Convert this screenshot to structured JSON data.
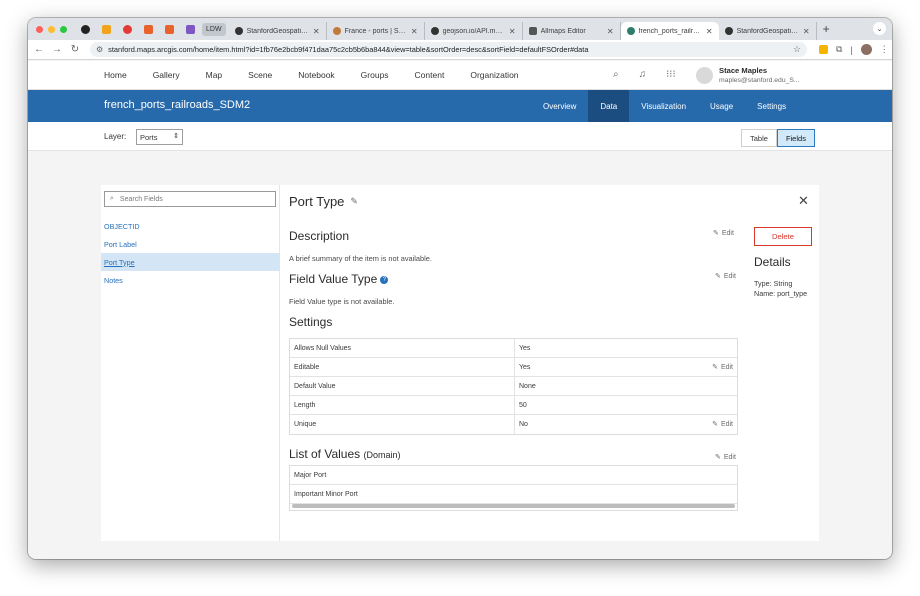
{
  "browser": {
    "pinned_tab_icons": [
      "github-icon",
      "chart-icon",
      "youtube-icon",
      "arcgis-icon",
      "wrench-icon",
      "vscode-icon"
    ],
    "ldw_label": "LDW",
    "tabs": [
      {
        "title": "StanfordGeospatialCe",
        "icon": "github-icon",
        "color": "#333333"
      },
      {
        "title": "France - ports | Stanfo",
        "icon": "globe-icon",
        "color": "#c07a3a"
      },
      {
        "title": "geojson.io/API.md at",
        "icon": "github-icon",
        "color": "#333333"
      },
      {
        "title": "Allmaps Editor",
        "icon": "map-icon",
        "color": "#555555"
      },
      {
        "title": "french_ports_railroad",
        "icon": "arcgis-icon",
        "color": "#2e7d6b",
        "active": true
      },
      {
        "title": "StanfordGeospatialCe",
        "icon": "github-icon",
        "color": "#333333"
      }
    ],
    "url": "stanford.maps.arcgis.com/home/item.html?id=1fb76e2bcb9f471daa75c2cb5b6ba844&view=table&sortOrder=desc&sortField=defaultFSOrder#data"
  },
  "topnav": {
    "links": [
      "Home",
      "Gallery",
      "Map",
      "Scene",
      "Notebook",
      "Groups",
      "Content",
      "Organization"
    ],
    "user_name": "Stace Maples",
    "user_email": "maples@stanford.edu_S..."
  },
  "item": {
    "title": "french_ports_railroads_SDM2",
    "tabs": [
      "Overview",
      "Data",
      "Visualization",
      "Usage",
      "Settings"
    ],
    "active_tab": "Data"
  },
  "layerbar": {
    "label": "Layer:",
    "layer_value": "Ports",
    "toggle": [
      "Table",
      "Fields"
    ],
    "active_toggle": "Fields"
  },
  "fields": {
    "search_placeholder": "Search Fields",
    "items": [
      "OBJECTID",
      "Port Label",
      "Port Type",
      "Notes"
    ],
    "selected": "Port Type"
  },
  "detail": {
    "field_title": "Port Type",
    "description_heading": "Description",
    "description_text": "A brief summary of the item is not available.",
    "field_value_type_heading": "Field Value Type",
    "field_value_type_text": "Field Value type is not available.",
    "edit_label": "Edit",
    "settings_heading": "Settings",
    "settings_rows": [
      {
        "key": "Allows Null Values",
        "value": "Yes",
        "editable": false
      },
      {
        "key": "Editable",
        "value": "Yes",
        "editable": true
      },
      {
        "key": "Default Value",
        "value": "None",
        "editable": false
      },
      {
        "key": "Length",
        "value": "50",
        "editable": false
      },
      {
        "key": "Unique",
        "value": "No",
        "editable": true
      }
    ],
    "list_of_values_heading": "List of Values",
    "list_of_values_sub": "(Domain)",
    "list_of_values": [
      "Major Port",
      "Important Minor Port"
    ],
    "delete_label": "Delete",
    "details_heading": "Details",
    "details_type": "Type: String",
    "details_name": "Name: port_type"
  },
  "colors": {
    "header_blue": "#276aac",
    "active_tab_blue": "#1c4d80",
    "link_blue": "#2671bb",
    "delete_red": "#d8392b"
  }
}
